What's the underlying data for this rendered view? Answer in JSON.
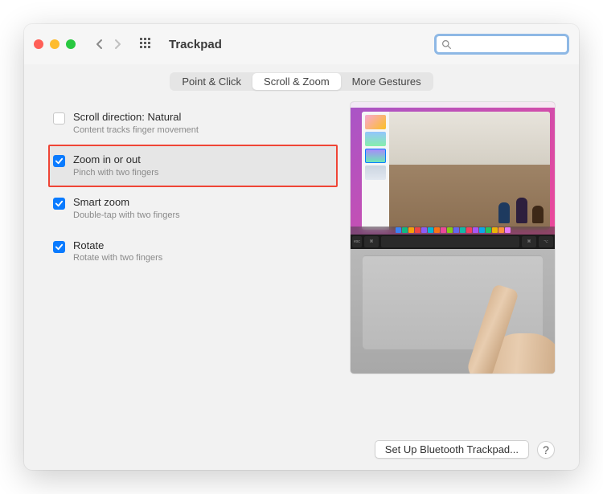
{
  "window": {
    "title": "Trackpad"
  },
  "search": {
    "placeholder": "",
    "value": ""
  },
  "tabs": [
    {
      "label": "Point & Click",
      "active": false
    },
    {
      "label": "Scroll & Zoom",
      "active": true
    },
    {
      "label": "More Gestures",
      "active": false
    }
  ],
  "options": [
    {
      "id": "scroll-direction",
      "title": "Scroll direction: Natural",
      "desc": "Content tracks finger movement",
      "checked": false,
      "highlighted": false
    },
    {
      "id": "zoom",
      "title": "Zoom in or out",
      "desc": "Pinch with two fingers",
      "checked": true,
      "highlighted": true
    },
    {
      "id": "smart-zoom",
      "title": "Smart zoom",
      "desc": "Double-tap with two fingers",
      "checked": true,
      "highlighted": false
    },
    {
      "id": "rotate",
      "title": "Rotate",
      "desc": "Rotate with two fingers",
      "checked": true,
      "highlighted": false
    }
  ],
  "footer": {
    "setup_button": "Set Up Bluetooth Trackpad...",
    "help_label": "?"
  },
  "dock_colors": [
    "#3b82f6",
    "#10b981",
    "#f59e0b",
    "#ef4444",
    "#8b5cf6",
    "#06b6d4",
    "#f97316",
    "#ec4899",
    "#84cc16",
    "#6366f1",
    "#14b8a6",
    "#f43f5e",
    "#a855f7",
    "#0ea5e9",
    "#22c55e",
    "#eab308",
    "#fb923c",
    "#e879f9"
  ]
}
